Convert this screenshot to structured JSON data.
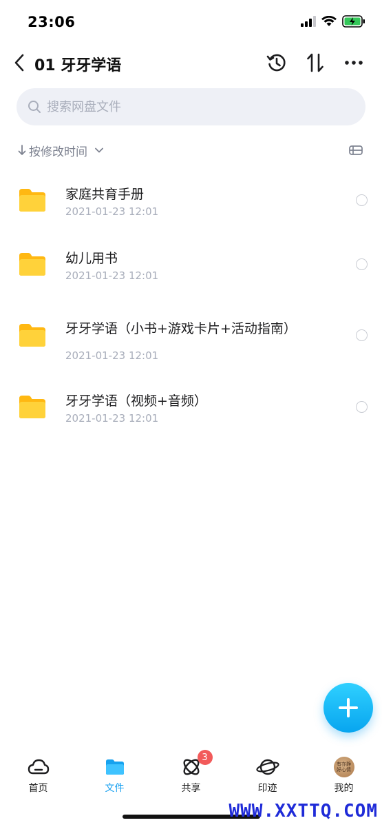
{
  "status": {
    "time": "23:06"
  },
  "nav": {
    "title": "01 牙牙学语"
  },
  "search": {
    "placeholder": "搜索网盘文件"
  },
  "sort": {
    "label": "按修改时间"
  },
  "files": [
    {
      "name": "家庭共育手册",
      "date": "2021-01-23 12:01"
    },
    {
      "name": "幼儿用书",
      "date": "2021-01-23 12:01"
    },
    {
      "name": "牙牙学语（小书+游戏卡片+活动指南）",
      "date": "2021-01-23 12:01"
    },
    {
      "name": "牙牙学语（视频+音频）",
      "date": "2021-01-23 12:01"
    }
  ],
  "tabs": [
    {
      "label": "首页",
      "icon": "cloud-icon",
      "active": false
    },
    {
      "label": "文件",
      "icon": "folder-icon",
      "active": true
    },
    {
      "label": "共享",
      "icon": "orbit-icon",
      "active": false,
      "badge": "3"
    },
    {
      "label": "印迹",
      "icon": "planet-icon",
      "active": false
    },
    {
      "label": "我的",
      "icon": "avatar",
      "active": false,
      "avatar_text": "有亦静 好心情"
    }
  ],
  "watermark": "WWW.XXTTQ.COM",
  "colors": {
    "accent": "#1aa1f0",
    "folder": "#ffc51a",
    "badge": "#f25a5a"
  }
}
